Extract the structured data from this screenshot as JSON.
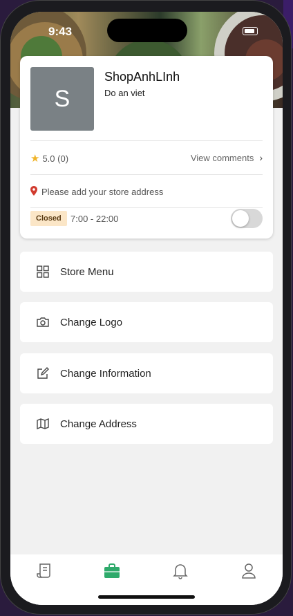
{
  "status": {
    "time": "9:43"
  },
  "store": {
    "avatar_letter": "S",
    "name": "ShopAnhLInh",
    "description": "Do an viet",
    "rating": "5.0 (0)",
    "view_comments": "View comments",
    "address": "Please add your store address",
    "status_badge": "Closed",
    "hours": "7:00 - 22:00",
    "open_toggle_on": false
  },
  "menu": [
    {
      "label": "Store Menu",
      "icon": "grid-icon"
    },
    {
      "label": "Change Logo",
      "icon": "camera-icon"
    },
    {
      "label": "Change Information",
      "icon": "edit-icon"
    },
    {
      "label": "Change Address",
      "icon": "map-icon"
    }
  ],
  "tabs": [
    {
      "name": "orders",
      "icon": "receipt-icon"
    },
    {
      "name": "store",
      "icon": "briefcase-icon",
      "active": true
    },
    {
      "name": "notifications",
      "icon": "bell-icon"
    },
    {
      "name": "profile",
      "icon": "user-icon"
    }
  ],
  "colors": {
    "accent": "#2eaa6b",
    "star": "#f0b429",
    "closed_badge_bg": "#fbe6c7",
    "pin": "#d13b2f"
  }
}
